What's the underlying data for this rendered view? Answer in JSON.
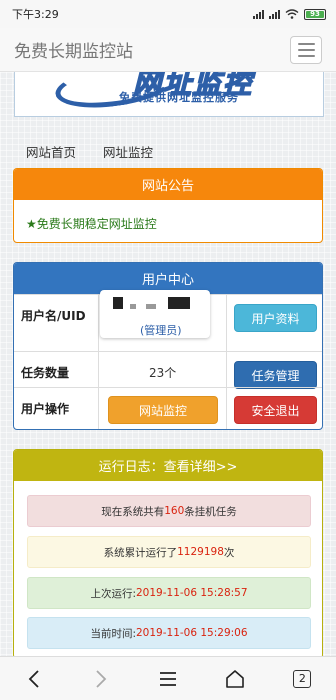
{
  "status_bar": {
    "time": "下午3:29",
    "battery": "93"
  },
  "navbar": {
    "site_name": "免费长期监控站",
    "menu_icon": "hamburger-icon"
  },
  "banner": {
    "logo_title": "网址监控",
    "logo_subtitle": "免费提供网址监控服务"
  },
  "crumbs": [
    "网站首页",
    "网址监控"
  ],
  "notice": {
    "title": "网站公告",
    "content": "★免费长期稳定网址监控",
    "header_color": "#f6870c"
  },
  "user_panel": {
    "title": "用户中心",
    "rows": {
      "uid_label": "用户名/UID",
      "role": "管理员",
      "profile_button": "用户资料",
      "tasks_label": "任务数量",
      "task_count": "23个",
      "task_manage_button": "任务管理",
      "ops_label": "用户操作",
      "monitor_button": "网站监控",
      "logout_button": "安全退出"
    },
    "header_color": "#3375bf"
  },
  "log_panel": {
    "title": "运行日志：查看详细>>",
    "header_color": "#c0b511",
    "items": {
      "tasks_prefix": "现在系统共有",
      "tasks_value": "160",
      "tasks_suffix": "条挂机任务",
      "runs_prefix": "系统累计运行了",
      "runs_value": "1129198",
      "runs_suffix": "次",
      "last_prefix": "上次运行:",
      "last_value": "2019-11-06 15:28:57",
      "now_prefix": "当前时间:",
      "now_value": "2019-11-06 15:29:06"
    }
  },
  "bottom_nav": {
    "tab_count": "2"
  }
}
